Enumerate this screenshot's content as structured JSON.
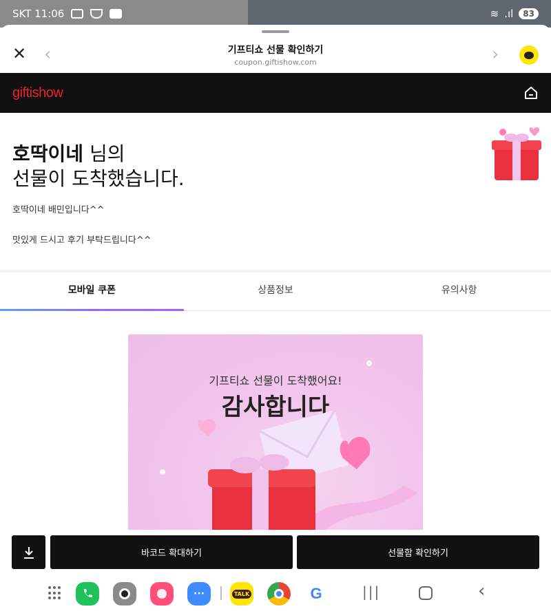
{
  "status": {
    "carrier_time": "SKT 11:06",
    "battery": "83"
  },
  "browser": {
    "title": "기프티쇼 선물 확인하기",
    "url": "coupon.giftishow.com"
  },
  "site": {
    "logo": "giftishow"
  },
  "greeting": {
    "sender": "호딱이네",
    "line1_suffix": " 님의",
    "line2": "선물이 도착했습니다."
  },
  "messages": [
    "호딱이네 배민입니다^^",
    "맛있게 드시고 후기 부탁드립니다^^"
  ],
  "tabs": [
    {
      "label": "모바일 쿠폰",
      "active": true
    },
    {
      "label": "상품정보",
      "active": false
    },
    {
      "label": "유의사항",
      "active": false
    }
  ],
  "coupon": {
    "subtitle": "기프티쇼 선물이 도착했어요!",
    "title": "감사합니다"
  },
  "actions": {
    "barcode": "바코드 확대하기",
    "giftbox": "선물함 확인하기"
  },
  "apps": [
    {
      "name": "phone",
      "color": "#1fc15a"
    },
    {
      "name": "camera",
      "color": "#6e6e6e"
    },
    {
      "name": "gallery",
      "color": "#ff4f7a"
    },
    {
      "name": "messages",
      "color": "#3d8bff"
    },
    {
      "name": "kakaotalk",
      "color": "#ffe500",
      "label": "TALK"
    },
    {
      "name": "chrome",
      "color": "#e94235"
    },
    {
      "name": "google",
      "color": "#4285f4"
    }
  ],
  "colors": {
    "accent_logo": "#e8232a",
    "tab_underline": "#8e6bff",
    "kakao_yellow": "#ffe500"
  }
}
